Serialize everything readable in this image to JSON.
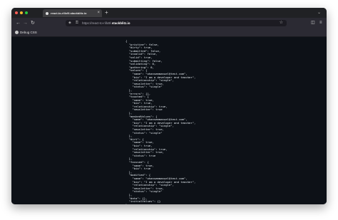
{
  "browser": {
    "tab": {
      "title": "react-to-rillx9l.stackblitz.io",
      "close": "×"
    },
    "new_tab": "+",
    "tab_list": "⌄",
    "nav": {
      "back": "←",
      "forward": "→",
      "reload": "↻"
    },
    "url": {
      "prefix": "https://react-to-rillx9l.",
      "domain": "stackblitz.io"
    },
    "bookmark": {
      "label": "Debug CSS"
    }
  },
  "json_output": [
    "{",
    "  \"pristine\": false,",
    "  \"dirty\": true,",
    "  \"submitted\": false,",
    "  \"invalid\": false,",
    "  \"valid\": true,",
    "  \"submitting\": false,",
    "  \"validating\": 0,",
    "  \"gathering\": 0,",
    "  \"values\": {",
    "    \"name\": \"ohansemmanuel@test.com\",",
    "    \"bio\": \"I am a developer and teacher\",",
    "    \"relationship\": \"single\",",
    "    \"newsletter\": true,",
    "    \"status\": \"single\"",
    "  },",
    "  \"errors\": {},",
    "  \"touched\": {",
    "    \"name\": true,",
    "    \"bio\": true,",
    "    \"relationship\": true,",
    "    \"newsletter\": true",
    "  },",
    "  \"maskedValues\": {",
    "    \"name\": \"ohansemmanuel@test.com\",",
    "    \"bio\": \"I am a developer and teacher\",",
    "    \"relationship\": \"single\",",
    "    \"newsletter\": true,",
    "    \"status\": \"single\"",
    "  },",
    "  \"dirt\": {",
    "    \"name\": true,",
    "    \"bio\": true,",
    "    \"relationship\": true,",
    "    \"newsletter\": true,",
    "    \"status\": true",
    "  },",
    "  \"focused\": {",
    "    \"name\": true,",
    "    \"bio\": true",
    "  },",
    "  \"modified\": {",
    "    \"name\": \"ohansemmanuel@test.com\",",
    "    \"bio\": \"I am a developer and teacher\",",
    "    \"relationship\": \"single\",",
    "    \"newsletter\": true,",
    "    \"status\": \"single\"",
    "  },",
    "  \"data\": {},",
    "  \"initialValues\": {}",
    "}"
  ]
}
